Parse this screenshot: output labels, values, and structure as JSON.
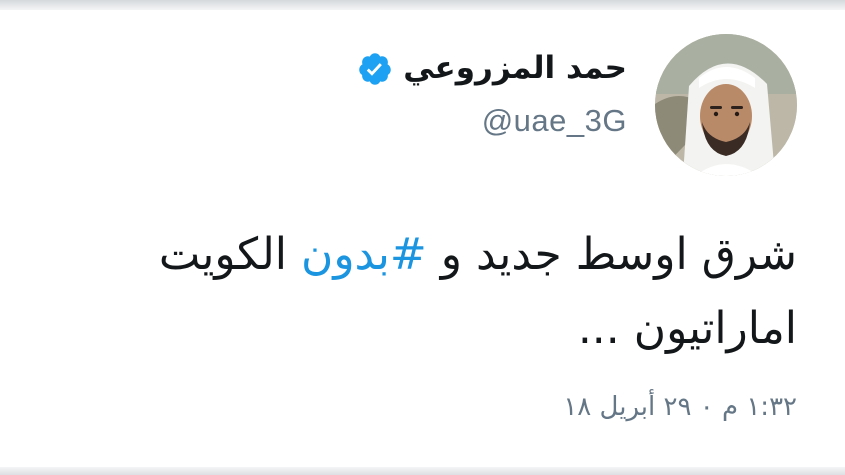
{
  "tweet": {
    "display_name": "حمد المزروعي",
    "handle": "@uae_3G",
    "verified": true,
    "text_part1": "شرق اوسط جديد و ",
    "hashtag": "#بدون",
    "text_part2": " الكويت اماراتيون ...",
    "timestamp": "١:٣٢ م ٠ ٢٩ أبريل ١٨"
  },
  "icons": {
    "verified": "verified-badge-icon",
    "avatar": "profile-photo"
  },
  "colors": {
    "hashtag": "#1b95e0",
    "verified_badge": "#1da1f2",
    "secondary_text": "#657786",
    "primary_text": "#14171a"
  }
}
